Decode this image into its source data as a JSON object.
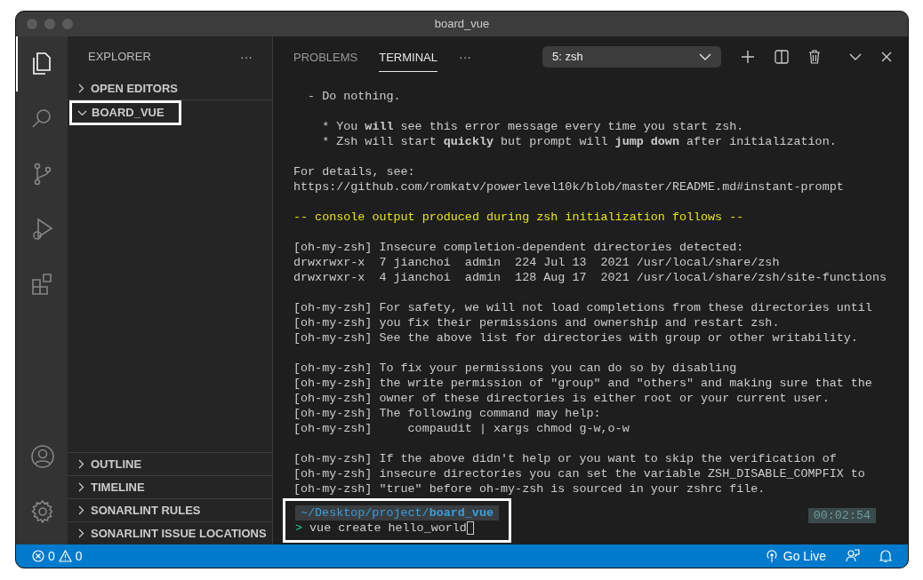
{
  "window": {
    "title": "board_vue"
  },
  "activity_bar": {
    "items": [
      {
        "kind": "files",
        "selected": true
      },
      {
        "kind": "search",
        "selected": false
      },
      {
        "kind": "source-control",
        "selected": false
      },
      {
        "kind": "run",
        "selected": false
      },
      {
        "kind": "extensions",
        "selected": false
      }
    ],
    "bottom": [
      {
        "kind": "account"
      },
      {
        "kind": "settings"
      }
    ]
  },
  "sidebar": {
    "title": "EXPLORER",
    "more": "···",
    "sections": [
      {
        "label": "OPEN EDITORS",
        "expanded": false,
        "highlighted": false
      },
      {
        "label": "BOARD_VUE",
        "expanded": true,
        "highlighted": true
      }
    ],
    "bottom_sections": [
      {
        "label": "OUTLINE",
        "expanded": false,
        "highlighted": false
      },
      {
        "label": "TIMELINE",
        "expanded": false,
        "highlighted": false
      },
      {
        "label": "SONARLINT RULES",
        "expanded": false,
        "highlighted": false
      },
      {
        "label": "SONARLINT ISSUE LOCATIONS",
        "expanded": false,
        "highlighted": false
      }
    ]
  },
  "panel": {
    "tabs": [
      {
        "label": "PROBLEMS",
        "selected": false
      },
      {
        "label": "TERMINAL",
        "selected": true
      }
    ],
    "more": "···",
    "terminal_select": "5: zsh",
    "terminal": [
      {
        "kind": "plain",
        "lines": [
          "  - Do nothing."
        ]
      },
      {
        "kind": "plain",
        "lines": [
          "    * You **will** see this error message every time you start zsh.",
          "    * Zsh will start **quickly** but prompt will **jump down** after initialization."
        ]
      },
      {
        "kind": "plain",
        "lines": [
          "For details, see:",
          "https://github.com/romkatv/powerlevel10k/blob/master/README.md#instant-prompt"
        ]
      },
      {
        "kind": "notice",
        "lines": [
          "-- console output produced during zsh initialization follows --"
        ]
      },
      {
        "kind": "plain",
        "lines": [
          "[oh-my-zsh] Insecure completion-dependent directories detected:",
          "drwxrwxr-x  7 jianchoi  admin  224 Jul 13  2021 /usr/local/share/zsh",
          "drwxrwxr-x  4 jianchoi  admin  128 Aug 17  2021 /usr/local/share/zsh/site-functions"
        ]
      },
      {
        "kind": "plain",
        "lines": [
          "[oh-my-zsh] For safety, we will not load completions from these directories until",
          "[oh-my-zsh] you fix their permissions and ownership and restart zsh.",
          "[oh-my-zsh] See the above list for directories with group or other writability."
        ]
      },
      {
        "kind": "plain",
        "lines": [
          "[oh-my-zsh] To fix your permissions you can do so by disabling",
          "[oh-my-zsh] the write permission of \"group\" and \"others\" and making sure that the",
          "[oh-my-zsh] owner of these directories is either root or your current user.",
          "[oh-my-zsh] The following command may help:",
          "[oh-my-zsh]     compaudit | xargs chmod g-w,o-w"
        ]
      },
      {
        "kind": "plain",
        "lines": [
          "[oh-my-zsh] If the above didn't help or you want to skip the verification of",
          "[oh-my-zsh] insecure directories you can set the variable ZSH_DISABLE_COMPFIX to",
          "[oh-my-zsh] \"true\" before oh-my-zsh is sourced in your zshrc file."
        ]
      }
    ],
    "prompt": {
      "path": "~/Desktop/project/",
      "dir": "board_vue",
      "symbol": ">",
      "command": "vue create hello_world",
      "elapsed": "00:02:54",
      "highlighted": true
    }
  },
  "status_bar": {
    "errors": "0",
    "warnings": "0",
    "go_live": "Go Live"
  }
}
